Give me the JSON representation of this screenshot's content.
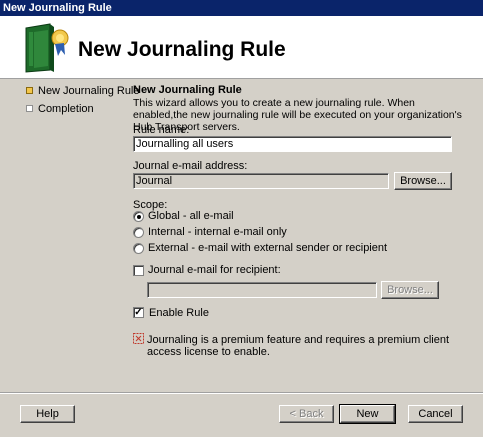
{
  "window": {
    "title": "New Journaling Rule"
  },
  "header": {
    "title": "New Journaling Rule"
  },
  "nav": {
    "items": [
      {
        "label": "New Journaling Rule",
        "state": "active"
      },
      {
        "label": "Completion",
        "state": "inactive"
      }
    ]
  },
  "page": {
    "section_title": "New Journaling Rule",
    "description": "This wizard allows you to create a new journaling rule. When enabled,the new journaling rule will be executed on your organization's Hub Transport servers.",
    "rule_name_label": "Rule name:",
    "rule_name_value": "Journalling all users",
    "journal_email_label": "Journal e-mail address:",
    "journal_email_value": "Journal",
    "browse_label": "Browse...",
    "scope_label": "Scope:",
    "scope_options": [
      {
        "label": "Global - all e-mail",
        "selected": true
      },
      {
        "label": "Internal - internal e-mail only",
        "selected": false
      },
      {
        "label": "External - e-mail with external sender or recipient",
        "selected": false
      }
    ],
    "recipient_checkbox_label": "Journal e-mail for recipient:",
    "recipient_checked": false,
    "recipient_value": "",
    "recipient_browse_label": "Browse...",
    "enable_rule_label": "Enable Rule",
    "enable_rule_checked": true,
    "premium_note": "Journaling is a premium feature and requires a premium client access license to enable."
  },
  "footer": {
    "help_label": "Help",
    "back_label": "< Back",
    "new_label": "New",
    "cancel_label": "Cancel"
  },
  "colors": {
    "titlebar": "#0a246a",
    "dialog": "#d4d0c8",
    "active_step": "#f3c64a"
  }
}
